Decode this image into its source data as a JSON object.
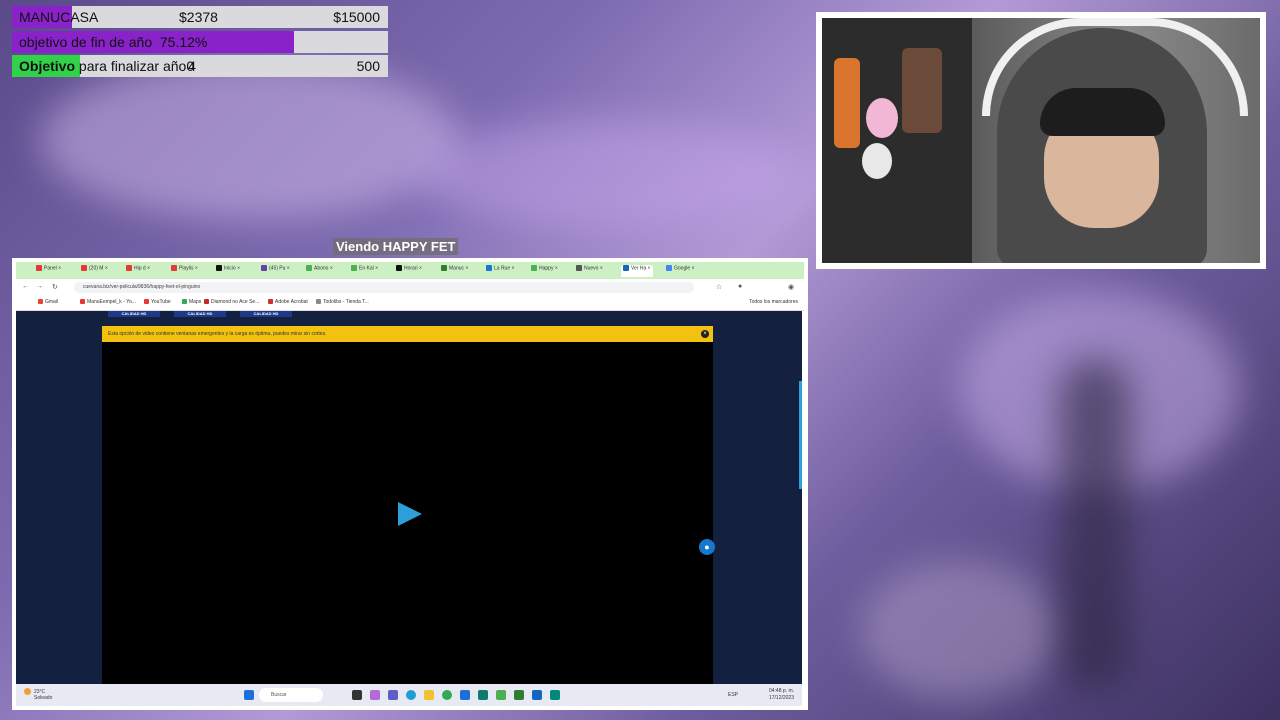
{
  "goals": {
    "row1": {
      "name_prefix": "MANU",
      "name_suffix": "CASA",
      "current": "$2378",
      "target": "$15000"
    },
    "row2": {
      "label": "objetivo de fin de año",
      "percent_text": "75.12%",
      "progress": 0.7512
    },
    "row3": {
      "label_bold": "Objetivo",
      "label_rest": "para finalizar año",
      "current": "0",
      "current_overlap": "4",
      "target": "500"
    }
  },
  "viewing_label": "Viendo HAPPY FET",
  "browser": {
    "tabs": [
      {
        "label": "Panel",
        "color": "#e53935"
      },
      {
        "label": "(20) M",
        "color": "#e53935"
      },
      {
        "label": "Hip d",
        "color": "#e53935"
      },
      {
        "label": "Playlis",
        "color": "#e53935"
      },
      {
        "label": "Inicio",
        "color": "#111111"
      },
      {
        "label": "(45) Pu",
        "color": "#6441a5"
      },
      {
        "label": "Abono",
        "color": "#4caf50"
      },
      {
        "label": "En Kal",
        "color": "#4caf50"
      },
      {
        "label": "Horari",
        "color": "#111111"
      },
      {
        "label": "Manuc",
        "color": "#2e7d32"
      },
      {
        "label": "La Rue",
        "color": "#1976d2"
      },
      {
        "label": "Happy",
        "color": "#4caf50"
      },
      {
        "label": "Nuevo",
        "color": "#555555"
      },
      {
        "label": "Ver Ha",
        "color": "#1565c0",
        "active": true
      },
      {
        "label": "Google",
        "color": "#4285f4"
      }
    ],
    "url": "cuevana.biz/ver-pelicula/9836/happy-feet-el-pinguino",
    "bookmarks": [
      {
        "label": "Gmail",
        "color": "#ea4335"
      },
      {
        "label": "ManuEempel_k - Yo...",
        "color": "#e53935"
      },
      {
        "label": "YouTube",
        "color": "#e53935"
      },
      {
        "label": "Maps",
        "color": "#34a853"
      },
      {
        "label": "Diamond no Ace Se...",
        "color": "#c62828"
      },
      {
        "label": "Adobe Acrobat",
        "color": "#d32f2f"
      },
      {
        "label": "Todolibs - Tienda T...",
        "color": "#888888"
      }
    ],
    "all_bookmarks": "Todos los marcadores",
    "hd_buttons": [
      "CALIDAD HD",
      "CALIDAD HD",
      "CALIDAD HD"
    ],
    "warning_text": "Esta opción de video contiene ventanas emergentes y la carga es óptima, puedes mirar sin cortes."
  },
  "taskbar": {
    "temp": "23°C",
    "weather": "Soleado",
    "search_placeholder": "Buscar",
    "time": "04:48 p. m.",
    "date": "17/12/2023",
    "lang": "ESP"
  }
}
